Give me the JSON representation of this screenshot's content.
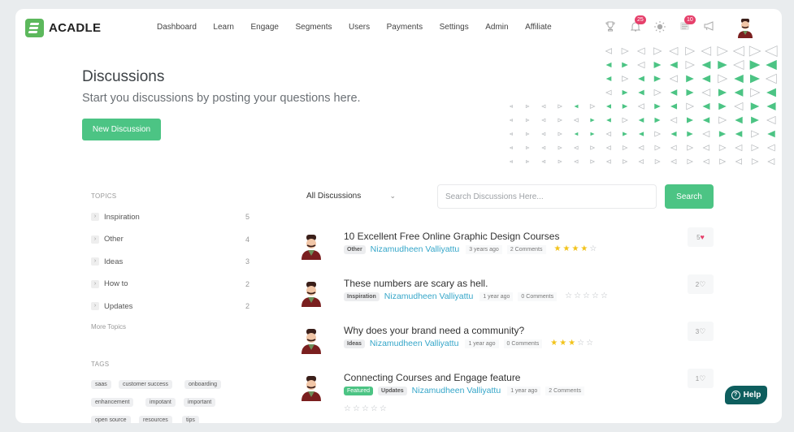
{
  "brand": {
    "name": "ACADLE",
    "color": "#5cb85c"
  },
  "nav": [
    "Dashboard",
    "Learn",
    "Engage",
    "Segments",
    "Users",
    "Payments",
    "Settings",
    "Admin",
    "Affiliate"
  ],
  "header_icons": {
    "trophy": "trophy-icon",
    "bell": {
      "icon": "bell-icon",
      "badge": "25"
    },
    "theme": "sun-icon",
    "messages": {
      "icon": "messages-icon",
      "badge": "10"
    },
    "announce": "megaphone-icon"
  },
  "hero": {
    "title": "Discussions",
    "subtitle": "Start you discussions by posting your questions here.",
    "new_button": "New Discussion"
  },
  "sidebar": {
    "topics_heading": "TOPICS",
    "topics": [
      {
        "label": "Inspiration",
        "count": "5"
      },
      {
        "label": "Other",
        "count": "4"
      },
      {
        "label": "Ideas",
        "count": "3"
      },
      {
        "label": "How to",
        "count": "2"
      },
      {
        "label": "Updates",
        "count": "2"
      }
    ],
    "more_topics": "More Topics",
    "tags_heading": "TAGS",
    "tags": [
      "saas",
      "customer success",
      "onboarding",
      "enhancement",
      "impotant",
      "important",
      "open source",
      "resources",
      "tips"
    ]
  },
  "toolbar": {
    "filter_selected": "All Discussions",
    "search_placeholder": "Search Discussions Here...",
    "search_button": "Search"
  },
  "posts": [
    {
      "title": "10 Excellent Free Online Graphic Design Courses",
      "badges": [
        "Other"
      ],
      "featured": false,
      "author": "Nizamudheen Valliyattu",
      "time": "3 years ago",
      "comments": "2 Comments",
      "rating": 4,
      "likes": "5",
      "liked": true
    },
    {
      "title": "These numbers are scary as hell.",
      "badges": [
        "Inspiration"
      ],
      "featured": false,
      "author": "Nizamudheen Valliyattu",
      "time": "1 year ago",
      "comments": "0 Comments",
      "rating": 0,
      "likes": "2",
      "liked": false
    },
    {
      "title": "Why does your brand need a community?",
      "badges": [
        "Ideas"
      ],
      "featured": false,
      "author": "Nizamudheen Valliyattu",
      "time": "1 year ago",
      "comments": "0 Comments",
      "rating": 3,
      "likes": "3",
      "liked": false
    },
    {
      "title": "Connecting Courses and Engage feature",
      "badges": [
        "Featured",
        "Updates"
      ],
      "featured": true,
      "author": "Nizamudheen Valliyattu",
      "time": "1 year ago",
      "comments": "2 Comments",
      "rating": 0,
      "likes": "1",
      "liked": false
    }
  ],
  "help_button": "Help",
  "colors": {
    "accent": "#4cc484",
    "author": "#35a6c9",
    "badge": "#e6406b",
    "help": "#0e5e5e",
    "star": "#f2c31a"
  }
}
